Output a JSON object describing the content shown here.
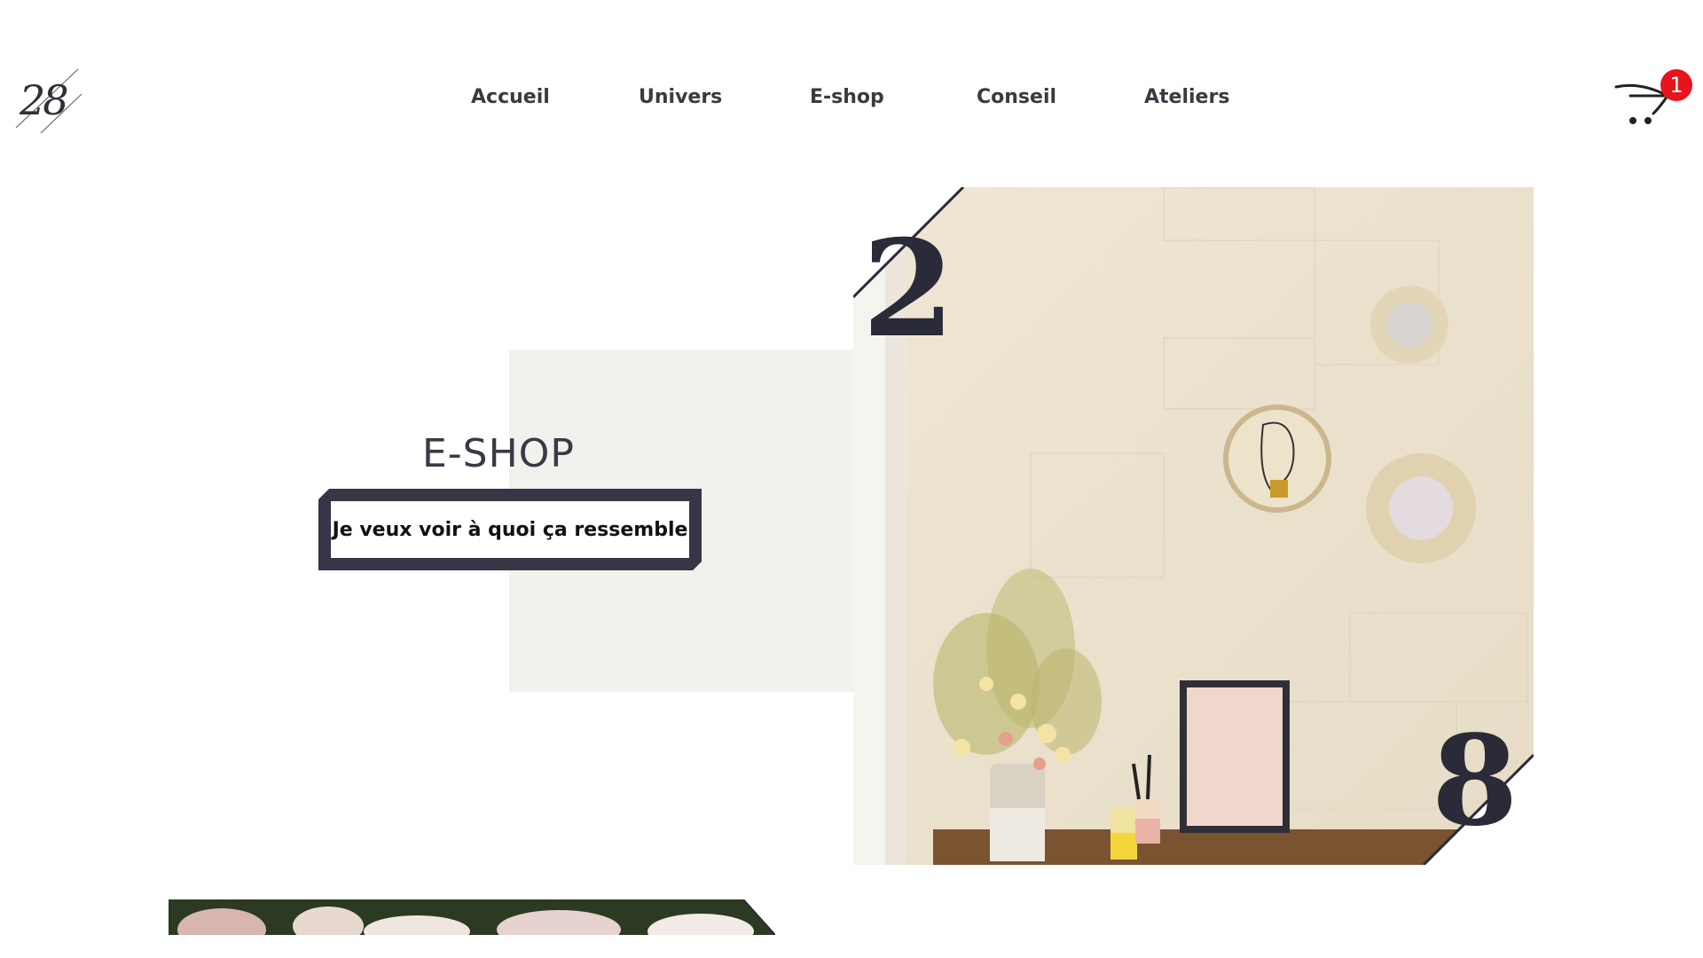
{
  "brand": {
    "logo_text": "28"
  },
  "nav": {
    "items": [
      {
        "label": "Accueil"
      },
      {
        "label": "Univers"
      },
      {
        "label": "E-shop"
      },
      {
        "label": "Conseil"
      },
      {
        "label": "Ateliers"
      }
    ]
  },
  "cart": {
    "count": "1",
    "icon": "cart-icon",
    "badge_color": "#e8141c"
  },
  "hero": {
    "title": "E-SHOP",
    "cta_label": "Je veux voir à quoi ça ressemble",
    "panel_color": "#f1f2ee",
    "frame_color": "#363646"
  },
  "photo": {
    "digit_top": "2",
    "digit_bottom": "8"
  }
}
